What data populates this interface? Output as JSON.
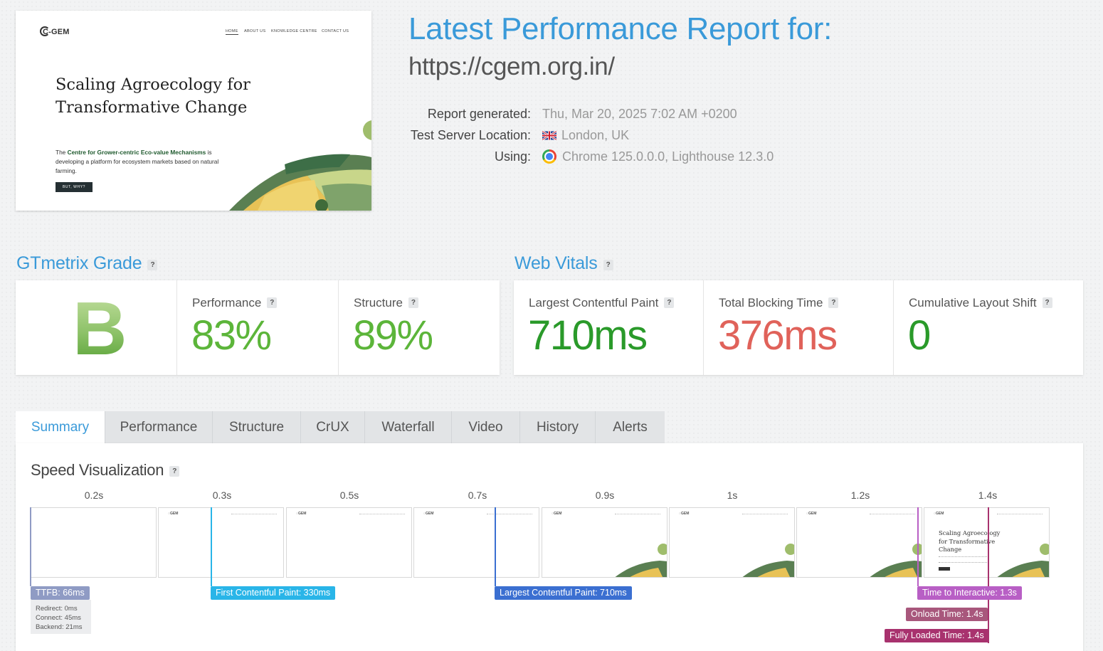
{
  "preview": {
    "logo": "C-GEM",
    "nav": [
      "HOME",
      "ABOUT US",
      "KNOWLEDGE CENTRE",
      "CONTACT US"
    ],
    "hero_title": "Scaling Agroecology for Transformative Change",
    "subtitle_bold": "Centre for Grower-centric Eco-value Mechanisms",
    "subtitle_prefix": "The ",
    "subtitle_rest": " is developing a platform for ecosystem markets based on natural farming.",
    "cta": "BUT, WHY?"
  },
  "report": {
    "title": "Latest Performance Report for:",
    "url": "https://cgem.org.in/",
    "meta": [
      {
        "label": "Report generated:",
        "value": "Thu, Mar 20, 2025 7:02 AM +0200",
        "icon": ""
      },
      {
        "label": "Test Server Location:",
        "value": "London, UK",
        "icon": "uk-flag-icon"
      },
      {
        "label": "Using:",
        "value": "Chrome 125.0.0.0, Lighthouse 12.3.0",
        "icon": "chrome-icon"
      }
    ]
  },
  "grade": {
    "heading": "GTmetrix Grade",
    "help": "?",
    "letter": "B",
    "performance_label": "Performance",
    "performance_value": "83%",
    "structure_label": "Structure",
    "structure_value": "89%"
  },
  "vitals": {
    "heading": "Web Vitals",
    "help": "?",
    "lcp_label": "Largest Contentful Paint",
    "lcp_value": "710ms",
    "tbt_label": "Total Blocking Time",
    "tbt_value": "376ms",
    "cls_label": "Cumulative Layout Shift",
    "cls_value": "0"
  },
  "colors": {
    "accent": "#3a9ad9",
    "good": "#4fa82c",
    "lcp_green": "#2e9e2e",
    "bad": "#e0625a"
  },
  "tabs": [
    "Summary",
    "Performance",
    "Structure",
    "CrUX",
    "Waterfall",
    "Video",
    "History",
    "Alerts"
  ],
  "speed": {
    "title": "Speed Visualization",
    "help": "?",
    "frames": [
      "0.2s",
      "0.3s",
      "0.5s",
      "0.7s",
      "0.9s",
      "1s",
      "1.2s",
      "1.4s"
    ],
    "last_frame_text": "Scaling Agroecology for Transformative Change",
    "ttfb": "TTFB: 66ms",
    "ttfb_details": [
      "Redirect: 0ms",
      "Connect: 45ms",
      "Backend: 21ms"
    ],
    "fcp": "First Contentful Paint: 330ms",
    "lcp": "Largest Contentful Paint: 710ms",
    "tti": "Time to Interactive: 1.3s",
    "onload": "Onload Time: 1.4s",
    "fully_loaded": "Fully Loaded Time: 1.4s"
  }
}
